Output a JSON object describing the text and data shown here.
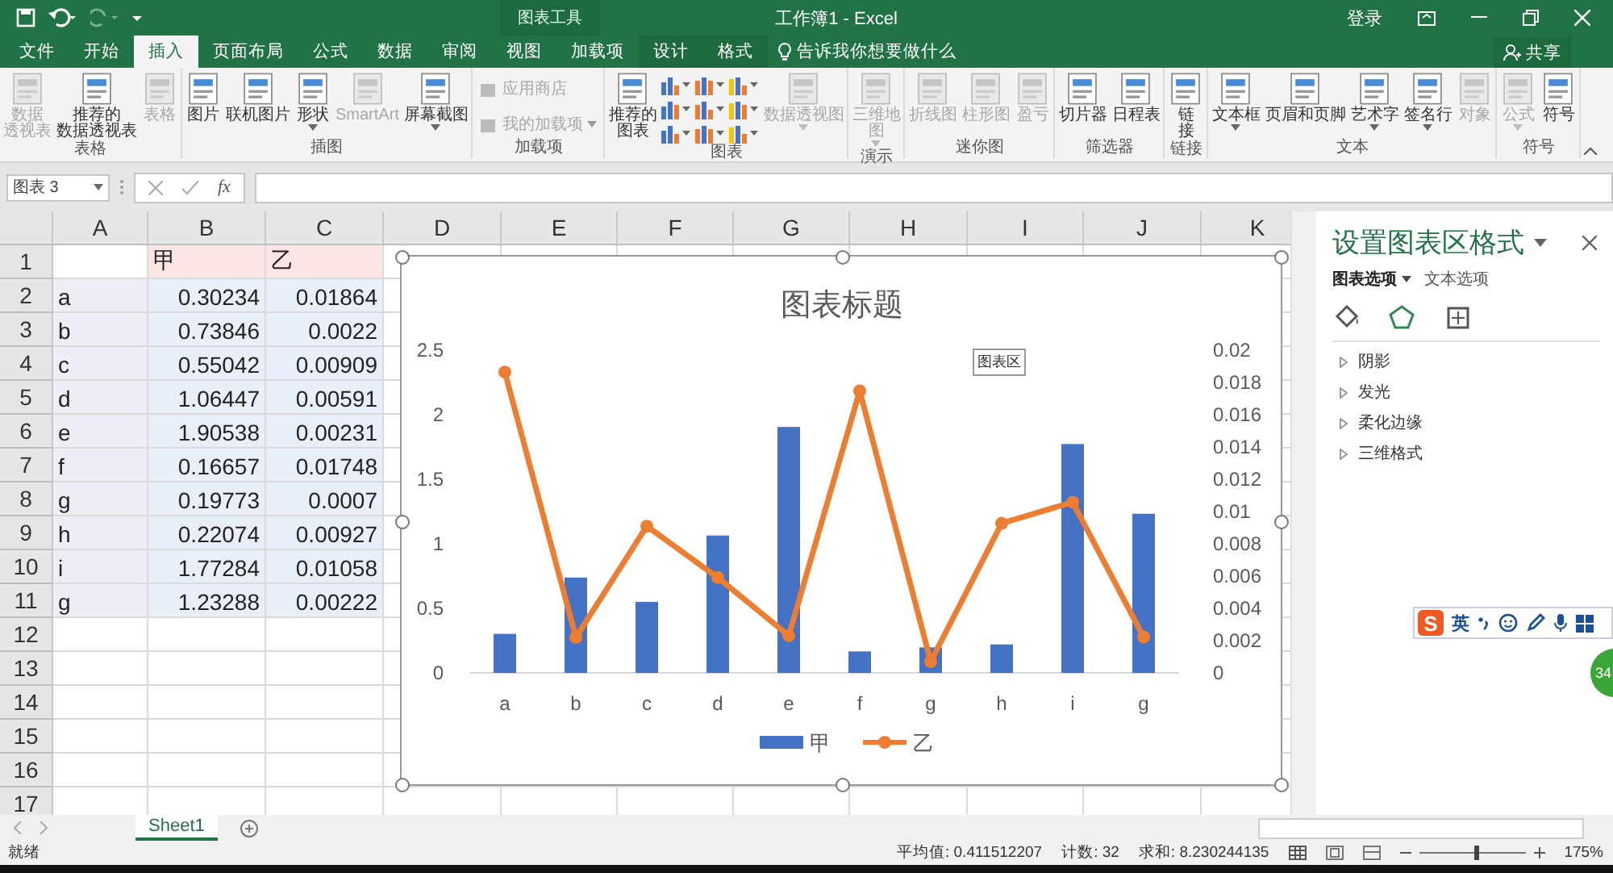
{
  "window": {
    "tool_context": "图表工具",
    "title": "工作簿1 - Excel",
    "sign_in": "登录",
    "share": "共享"
  },
  "menu_tabs": [
    {
      "label": "文件",
      "selected": false,
      "kind": "normal"
    },
    {
      "label": "开始",
      "selected": false,
      "kind": "normal"
    },
    {
      "label": "插入",
      "selected": true,
      "kind": "normal"
    },
    {
      "label": "页面布局",
      "selected": false,
      "kind": "normal"
    },
    {
      "label": "公式",
      "selected": false,
      "kind": "normal"
    },
    {
      "label": "数据",
      "selected": false,
      "kind": "normal"
    },
    {
      "label": "审阅",
      "selected": false,
      "kind": "normal"
    },
    {
      "label": "视图",
      "selected": false,
      "kind": "normal"
    },
    {
      "label": "加载项",
      "selected": false,
      "kind": "normal"
    },
    {
      "label": "设计",
      "selected": false,
      "kind": "context"
    },
    {
      "label": "格式",
      "selected": false,
      "kind": "context"
    }
  ],
  "tell_me": "告诉我你想要做什么",
  "ribbon_groups": [
    {
      "label": "表格",
      "items": [
        {
          "kind": "large",
          "lines": [
            "数据",
            "透视表"
          ],
          "disabled": true,
          "dropdown": false
        },
        {
          "kind": "large",
          "lines": [
            "推荐的",
            "数据透视表"
          ],
          "disabled": false,
          "dropdown": false
        },
        {
          "kind": "large",
          "lines": [
            "表格"
          ],
          "disabled": true,
          "dropdown": false
        }
      ]
    },
    {
      "label": "插图",
      "items": [
        {
          "kind": "large",
          "lines": [
            "图片"
          ],
          "disabled": false,
          "dropdown": false
        },
        {
          "kind": "large",
          "lines": [
            "联机图片"
          ],
          "disabled": false,
          "dropdown": false
        },
        {
          "kind": "large",
          "lines": [
            "形状"
          ],
          "disabled": false,
          "dropdown": true
        },
        {
          "kind": "large",
          "lines": [
            "SmartArt"
          ],
          "disabled": true,
          "dropdown": false
        },
        {
          "kind": "large",
          "lines": [
            "屏幕截图"
          ],
          "disabled": false,
          "dropdown": true
        }
      ]
    },
    {
      "label": "加载项",
      "items": [
        {
          "kind": "small",
          "lines": [
            "应用商店"
          ],
          "disabled": true,
          "dropdown": false
        },
        {
          "kind": "small",
          "lines": [
            "我的加载项"
          ],
          "disabled": true,
          "dropdown": true
        }
      ]
    },
    {
      "label": "图表",
      "items": [
        {
          "kind": "large",
          "lines": [
            "推荐的",
            "图表"
          ],
          "disabled": false,
          "dropdown": false
        },
        {
          "kind": "gallery",
          "disabled": false,
          "dropdown": true
        },
        {
          "kind": "large",
          "lines": [
            "数据透视图"
          ],
          "disabled": true,
          "dropdown": true
        }
      ]
    },
    {
      "label": "演示",
      "items": [
        {
          "kind": "large",
          "lines": [
            "三维地",
            "图"
          ],
          "disabled": true,
          "dropdown": true
        }
      ]
    },
    {
      "label": "迷你图",
      "items": [
        {
          "kind": "large",
          "lines": [
            "折线图"
          ],
          "disabled": true,
          "dropdown": false
        },
        {
          "kind": "large",
          "lines": [
            "柱形图"
          ],
          "disabled": true,
          "dropdown": false
        },
        {
          "kind": "large",
          "lines": [
            "盈亏"
          ],
          "disabled": true,
          "dropdown": false
        }
      ]
    },
    {
      "label": "筛选器",
      "items": [
        {
          "kind": "large",
          "lines": [
            "切片器"
          ],
          "disabled": false,
          "dropdown": false
        },
        {
          "kind": "large",
          "lines": [
            "日程表"
          ],
          "disabled": false,
          "dropdown": false
        }
      ]
    },
    {
      "label": "链接",
      "items": [
        {
          "kind": "large",
          "lines": [
            "链",
            "接"
          ],
          "disabled": false,
          "dropdown": false
        }
      ]
    },
    {
      "label": "文本",
      "items": [
        {
          "kind": "large",
          "lines": [
            "文本框"
          ],
          "disabled": false,
          "dropdown": true
        },
        {
          "kind": "large",
          "lines": [
            "页眉和页脚"
          ],
          "disabled": false,
          "dropdown": false
        },
        {
          "kind": "large",
          "lines": [
            "艺术字"
          ],
          "disabled": false,
          "dropdown": true
        },
        {
          "kind": "large",
          "lines": [
            "签名行"
          ],
          "disabled": false,
          "dropdown": true
        },
        {
          "kind": "large",
          "lines": [
            "对象"
          ],
          "disabled": true,
          "dropdown": false
        }
      ]
    },
    {
      "label": "符号",
      "items": [
        {
          "kind": "large",
          "lines": [
            "公式"
          ],
          "disabled": true,
          "dropdown": true
        },
        {
          "kind": "large",
          "lines": [
            "符号"
          ],
          "disabled": false,
          "dropdown": false
        }
      ]
    }
  ],
  "formula_bar": {
    "name_box": "图表 3",
    "function_label": "fx"
  },
  "sheet": {
    "columns": [
      "A",
      "B",
      "C",
      "D",
      "E",
      "F",
      "G",
      "H",
      "I",
      "J",
      "K"
    ],
    "row_numbers": [
      "1",
      "2",
      "3",
      "4",
      "5",
      "6",
      "7",
      "8",
      "9",
      "10",
      "11",
      "12",
      "13",
      "14",
      "15",
      "16",
      "17"
    ],
    "rows": [
      {
        "cells": [
          {
            "text": ""
          },
          {
            "text": "甲",
            "kind": "series_name"
          },
          {
            "text": "乙",
            "kind": "series_name"
          }
        ]
      },
      {
        "cells": [
          {
            "text": "a",
            "kind": "category"
          },
          {
            "text": "0.30234",
            "kind": "values"
          },
          {
            "text": "0.01864",
            "kind": "values"
          }
        ]
      },
      {
        "cells": [
          {
            "text": "b",
            "kind": "category"
          },
          {
            "text": "0.73846",
            "kind": "values"
          },
          {
            "text": "0.0022",
            "kind": "values"
          }
        ]
      },
      {
        "cells": [
          {
            "text": "c",
            "kind": "category"
          },
          {
            "text": "0.55042",
            "kind": "values"
          },
          {
            "text": "0.00909",
            "kind": "values"
          }
        ]
      },
      {
        "cells": [
          {
            "text": "d",
            "kind": "category"
          },
          {
            "text": "1.06447",
            "kind": "values"
          },
          {
            "text": "0.00591",
            "kind": "values"
          }
        ]
      },
      {
        "cells": [
          {
            "text": "e",
            "kind": "category"
          },
          {
            "text": "1.90538",
            "kind": "values"
          },
          {
            "text": "0.00231",
            "kind": "values"
          }
        ]
      },
      {
        "cells": [
          {
            "text": "f",
            "kind": "category"
          },
          {
            "text": "0.16657",
            "kind": "values"
          },
          {
            "text": "0.01748",
            "kind": "values"
          }
        ]
      },
      {
        "cells": [
          {
            "text": "g",
            "kind": "category"
          },
          {
            "text": "0.19773",
            "kind": "values"
          },
          {
            "text": "0.0007",
            "kind": "values"
          }
        ]
      },
      {
        "cells": [
          {
            "text": "h",
            "kind": "category"
          },
          {
            "text": "0.22074",
            "kind": "values"
          },
          {
            "text": "0.00927",
            "kind": "values"
          }
        ]
      },
      {
        "cells": [
          {
            "text": "i",
            "kind": "category"
          },
          {
            "text": "1.77284",
            "kind": "values"
          },
          {
            "text": "0.01058",
            "kind": "values"
          }
        ]
      },
      {
        "cells": [
          {
            "text": "g",
            "kind": "category"
          },
          {
            "text": "1.23288",
            "kind": "values"
          },
          {
            "text": "0.00222",
            "kind": "values"
          }
        ]
      }
    ]
  },
  "chart": {
    "selected": true,
    "tooltip": "图表区",
    "layers": [
      {
        "chart_data": {
          "type": "bar",
          "title": "图表标题",
          "legend": "bottom",
          "categories": [
            "a",
            "b",
            "c",
            "d",
            "e",
            "f",
            "g",
            "h",
            "i",
            "g"
          ],
          "series": [
            {
              "name": "甲",
              "color": "#4472c4",
              "values": [
                0.30234,
                0.73846,
                0.55042,
                1.06447,
                1.90538,
                0.16657,
                0.19773,
                0.22074,
                1.77284,
                1.23288
              ]
            }
          ],
          "ylim": [
            0,
            2.5
          ],
          "yticks": [
            0,
            0.5,
            1,
            1.5,
            2,
            2.5
          ]
        }
      },
      {
        "chart_data": {
          "type": "line",
          "series": [
            {
              "name": "乙",
              "color": "#ed7d31",
              "marker": "o",
              "values": [
                0.01864,
                0.0022,
                0.00909,
                0.00591,
                0.00231,
                0.01748,
                0.0007,
                0.00927,
                0.01058,
                0.00222
              ]
            }
          ],
          "ylim": [
            0,
            0.02
          ],
          "yticks": [
            0,
            0.002,
            0.004,
            0.006,
            0.008,
            0.01,
            0.012,
            0.014,
            0.016,
            0.018,
            0.02
          ]
        }
      }
    ]
  },
  "format_pane": {
    "title": "设置图表区格式",
    "tabs": [
      {
        "label": "图表选项",
        "selected": true
      },
      {
        "label": "文本选项",
        "selected": false
      }
    ],
    "icon_tabs": [
      {
        "selected": false
      },
      {
        "selected": true
      },
      {
        "selected": false
      }
    ],
    "sections": [
      {
        "label": "阴影",
        "expanded": false
      },
      {
        "label": "发光",
        "expanded": false
      },
      {
        "label": "柔化边缘",
        "expanded": false
      },
      {
        "label": "三维格式",
        "expanded": false
      }
    ]
  },
  "sheet_tabs": [
    {
      "label": "Sheet1",
      "selected": true
    }
  ],
  "status_bar": {
    "mode": "就绪",
    "average": "平均值: 0.411512207",
    "count": "计数: 32",
    "sum": "求和: 8.230244135",
    "zoom": "175%",
    "zoom_slider": {
      "level": 0.55
    }
  },
  "ime_toolbar": {
    "logo": "S",
    "mode": "英"
  },
  "floating_badge": {
    "text": "34"
  }
}
